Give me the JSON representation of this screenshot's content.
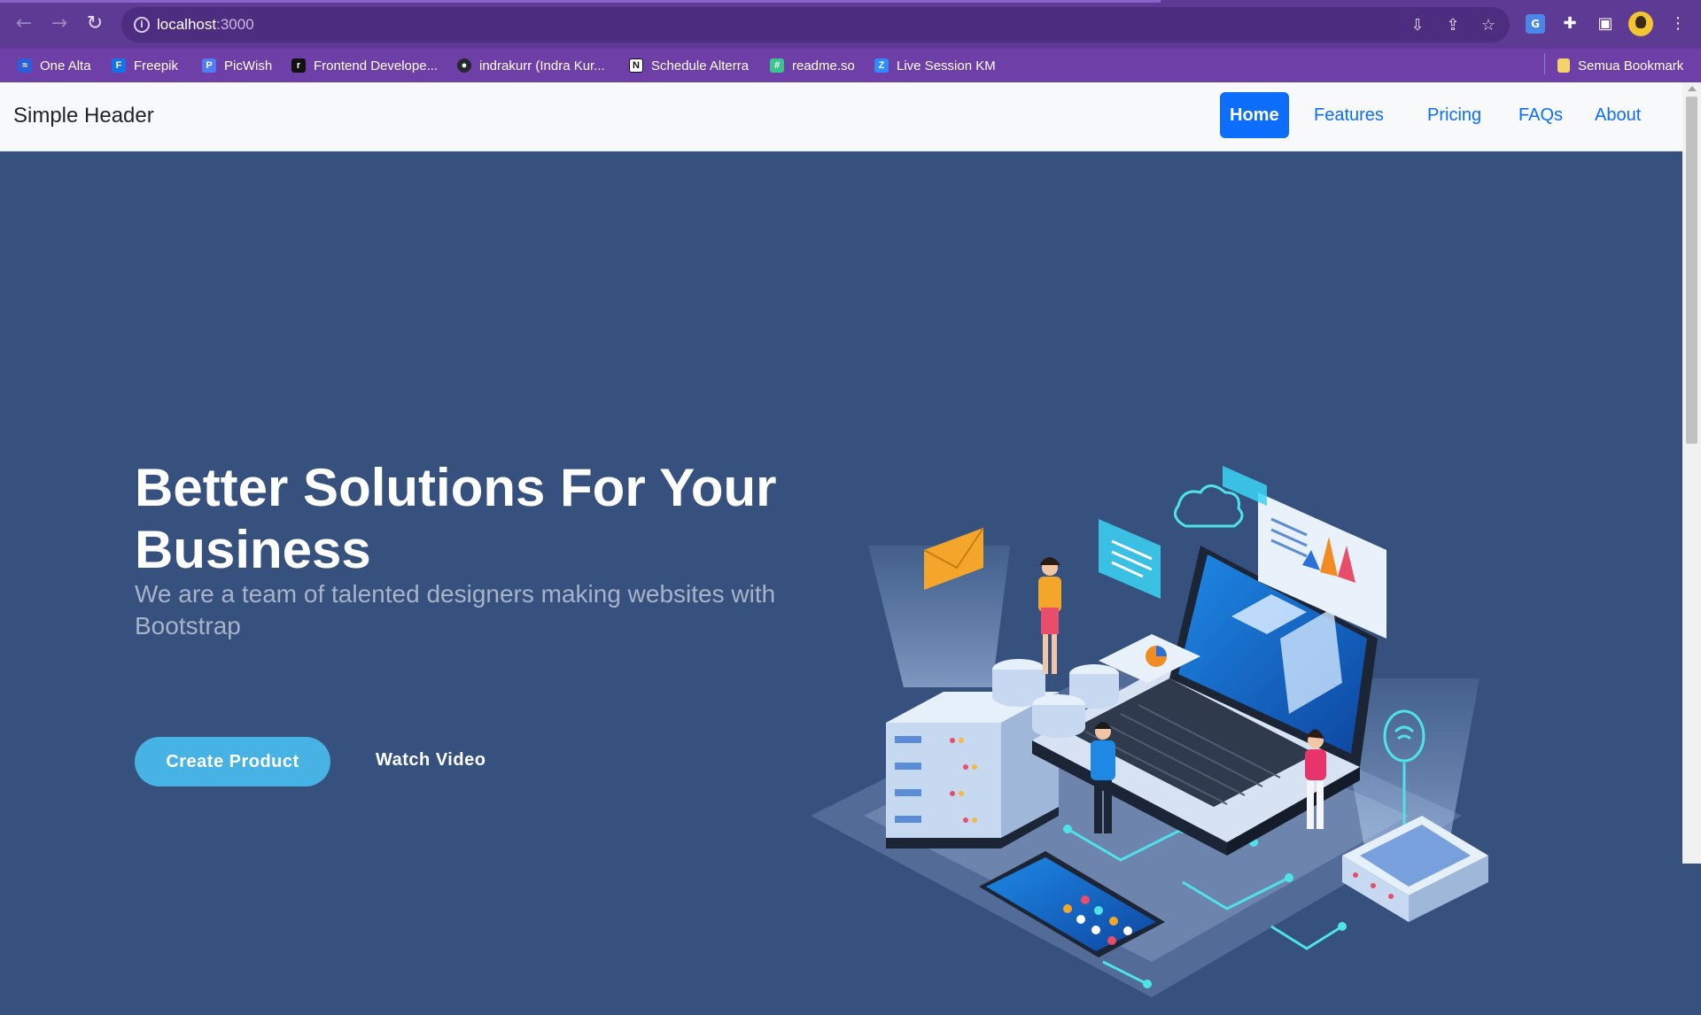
{
  "browser": {
    "url_host": "localhost",
    "url_port": ":3000",
    "bookmarks": [
      {
        "label": "One Alta",
        "color": "#2b5fd9"
      },
      {
        "label": "Freepik",
        "color": "#1273eb"
      },
      {
        "label": "PicWish",
        "color": "#4f7cf7"
      },
      {
        "label": "Frontend Develope...",
        "color": "#111111"
      },
      {
        "label": "indrakurr (Indra Kur...",
        "color": "#24292f"
      },
      {
        "label": "Schedule Alterra",
        "color": "#111111"
      },
      {
        "label": "readme.so",
        "color": "#3ac48e"
      },
      {
        "label": "Live Session KM",
        "color": "#2d8cff"
      }
    ],
    "all_bookmarks_label": "Semua Bookmark"
  },
  "header": {
    "brand": "Simple Header",
    "nav": [
      "Home",
      "Features",
      "Pricing",
      "FAQs",
      "About"
    ],
    "active_nav": "Home"
  },
  "hero": {
    "title": "Better Solutions For Your Business",
    "subtitle": "We are a team of talented designers making websites with Bootstrap",
    "primary_button": "Create Product",
    "secondary_button": "Watch Video"
  },
  "colors": {
    "hero_bg": "#37517e",
    "accent": "#47b2e4",
    "nav_active": "#0d6efd",
    "browser_frame": "#5d3a94"
  }
}
